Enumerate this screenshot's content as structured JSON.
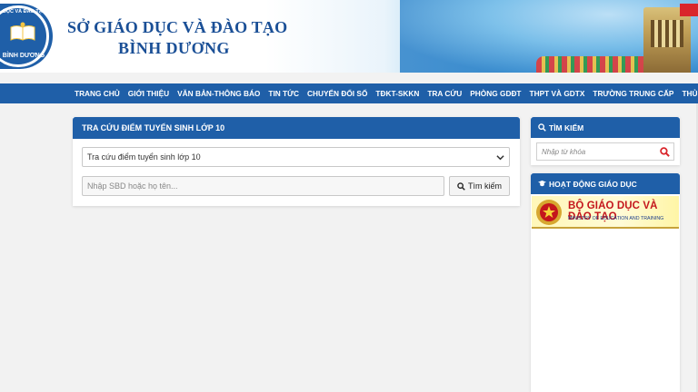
{
  "header": {
    "title_line1": "SỞ GIÁO DỤC VÀ ĐÀO TẠO",
    "title_line2": "BÌNH DƯƠNG",
    "logo_top_text": "DỤC VÀ ĐÀO TẠO",
    "logo_bottom_text": "BÌNH DƯƠNG"
  },
  "nav": {
    "items": [
      "TRANG CHỦ",
      "GIỚI THIỆU",
      "VĂN BẢN-THÔNG BÁO",
      "TIN TỨC",
      "CHUYỂN ĐỔI SỐ",
      "TĐKT-SKKN",
      "TRA CỨU",
      "PHÒNG GDĐT",
      "THPT VÀ GDTX",
      "TRƯỜNG TRUNG CẤP",
      "THỦ TỤC HÀNH C"
    ]
  },
  "main": {
    "panel_title": "TRA CỨU ĐIỂM TUYỂN SINH LỚP 10",
    "select_value": "Tra cứu điểm tuyển sinh lớp 10",
    "search_placeholder": "Nhập SBD hoặc họ tên...",
    "search_button": "Tìm kiếm"
  },
  "sidebar": {
    "search_title": "TÌM KIẾM",
    "search_placeholder": "Nhập từ khóa",
    "activities_title": "HOẠT ĐỘNG GIÁO DỤC",
    "moet_name": "BỘ GIÁO DỤC VÀ ĐÀO TẠO",
    "moet_sub": "MINISTRY OF EDUCATION AND TRAINING"
  },
  "colors": {
    "brand_blue": "#1f5fa8",
    "title_blue": "#1a4f96",
    "moet_red": "#c4161c"
  }
}
